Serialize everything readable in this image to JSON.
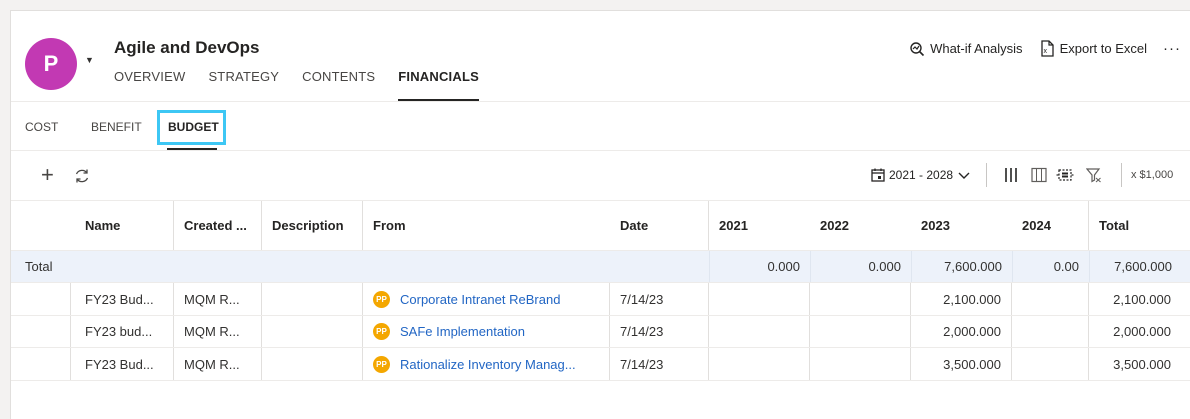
{
  "header": {
    "avatar_letter": "P",
    "title": "Agile and DevOps",
    "tabs": [
      "OVERVIEW",
      "STRATEGY",
      "CONTENTS",
      "FINANCIALS"
    ],
    "active_tab": "FINANCIALS",
    "actions": {
      "what_if": "What-if Analysis",
      "export": "Export to Excel",
      "more": "···"
    },
    "avatar_color": "#c239b3"
  },
  "subtabs": {
    "cost": "COST",
    "benefit": "BENEFIT",
    "budget": "BUDGET",
    "active": "BUDGET",
    "highlight_color": "#3dc7f4"
  },
  "toolbar": {
    "add_icon": "plus-icon",
    "refresh_icon": "refresh-icon",
    "date_range": "2021 - 2028",
    "scale": "x $1,000"
  },
  "grid": {
    "columns": [
      "Name",
      "Created ...",
      "Description",
      "From",
      "Date",
      "2021",
      "2022",
      "2023",
      "2024",
      "Total"
    ],
    "total_row": {
      "label": "Total",
      "y2021": "0.000",
      "y2022": "0.000",
      "y2023": "7,600.000",
      "y2024": "0.00",
      "total": "7,600.000"
    },
    "rows": [
      {
        "name": "FY23 Bud...",
        "created": "MQM R...",
        "description": "",
        "badge": "PP",
        "from": "Corporate Intranet ReBrand",
        "date": "7/14/23",
        "y2021": "",
        "y2022": "",
        "y2023": "2,100.000",
        "y2024": "",
        "total": "2,100.000"
      },
      {
        "name": "FY23 bud...",
        "created": "MQM R...",
        "description": "",
        "badge": "PP",
        "from": "SAFe Implementation",
        "date": "7/14/23",
        "y2021": "",
        "y2022": "",
        "y2023": "2,000.000",
        "y2024": "",
        "total": "2,000.000"
      },
      {
        "name": "FY23 Bud...",
        "created": "MQM R...",
        "description": "",
        "badge": "PP",
        "from": "Rationalize Inventory Manag...",
        "date": "7/14/23",
        "y2021": "",
        "y2022": "",
        "y2023": "3,500.000",
        "y2024": "",
        "total": "3,500.000"
      }
    ],
    "link_color": "#2266c4",
    "badge_color": "#f4a700"
  }
}
